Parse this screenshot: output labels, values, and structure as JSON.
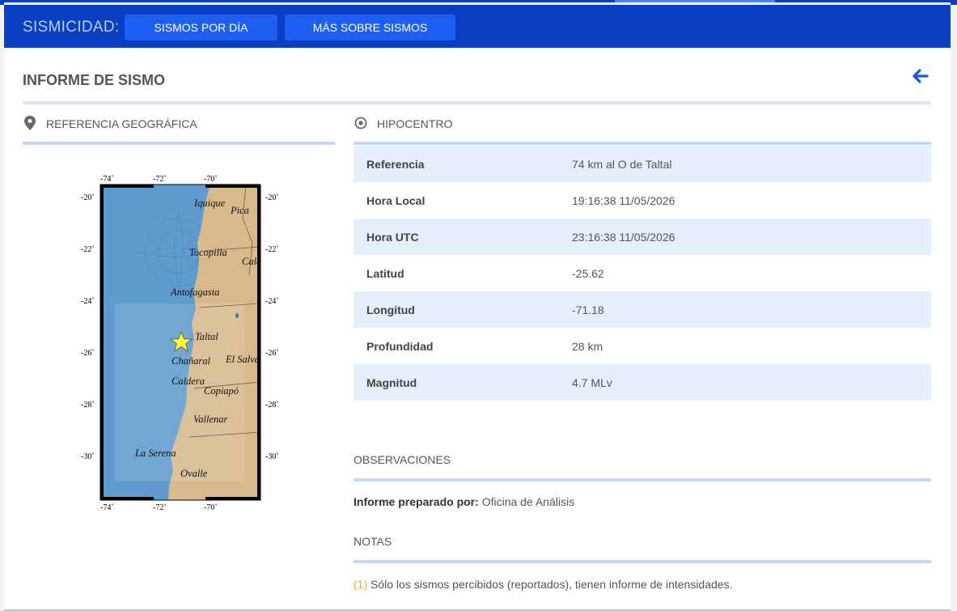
{
  "nav": {
    "title": "SISMICIDAD:",
    "buttons": [
      "SISMOS POR DÍA",
      "MÁS SOBRE SISMOS"
    ]
  },
  "report": {
    "title": "INFORME DE SISMO"
  },
  "geo": {
    "heading": "REFERENCIA GEOGRÁFICA"
  },
  "hypo": {
    "heading": "HIPOCENTRO",
    "rows": [
      {
        "label": "Referencia",
        "value": "74 km al O de Taltal"
      },
      {
        "label": "Hora Local",
        "value": "19:16:38 11/05/2026"
      },
      {
        "label": "Hora UTC",
        "value": "23:16:38 11/05/2026"
      },
      {
        "label": "Latitud",
        "value": "-25.62"
      },
      {
        "label": "Longitud",
        "value": "-71.18"
      },
      {
        "label": "Profundidad",
        "value": "28 km"
      },
      {
        "label": "Magnitud",
        "value": "4.7 MLv"
      }
    ]
  },
  "observations": {
    "heading": "OBSERVACIONES",
    "prepared_label": "Informe preparado por:",
    "prepared_value": "Oficina de Análisis"
  },
  "notes": {
    "heading": "NOTAS",
    "number": "(1)",
    "text": "Sólo los sismos percibidos (reportados), tienen informe de intensidades."
  },
  "map": {
    "lon_ticks": [
      "-74˚",
      "-72˚",
      "-70˚"
    ],
    "lat_ticks": [
      "-20˚",
      "-22˚",
      "-24˚",
      "-26˚",
      "-28˚",
      "-30˚"
    ],
    "places": [
      "Iquique",
      "Pica",
      "Tocopilla",
      "Cala",
      "Antofagasta",
      "Taltal",
      "Chañaral",
      "El Salva",
      "Caldera",
      "Copiapó",
      "Vallenar",
      "La Serena",
      "Ovalle"
    ],
    "epicenter": {
      "lon": -71.18,
      "lat": -25.62
    },
    "colors": {
      "sea": "#5f9bcf",
      "land": "#d7b98c",
      "star": "#ffff33"
    }
  },
  "colors": {
    "nav": "#0a3fc4",
    "button": "#1d5ff0",
    "row_alt": "#e6eefb",
    "note_number": "#f0a04a"
  }
}
